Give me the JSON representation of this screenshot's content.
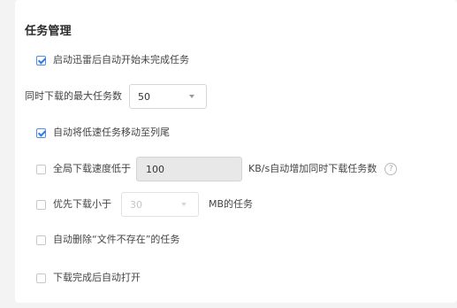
{
  "section": {
    "title": "任务管理"
  },
  "settings": {
    "auto_start": {
      "label": "启动迅雷后自动开始未完成任务",
      "checked": true
    },
    "max_tasks": {
      "label": "同时下载的最大任务数",
      "value": "50"
    },
    "move_slow": {
      "label": "自动将低速任务移动至列尾",
      "checked": true
    },
    "global_speed": {
      "label": "全局下载速度低于",
      "value": "100",
      "suffix": "KB/s自动增加同时下载任务数",
      "checked": false,
      "help_icon": "question-circle-icon"
    },
    "prefer_small": {
      "label": "优先下载小于",
      "value": "30",
      "suffix": "MB的任务",
      "checked": false
    },
    "auto_delete": {
      "label": "自动删除“文件不存在”的任务",
      "checked": false
    },
    "auto_open": {
      "label": "下载完成后自动打开",
      "checked": false
    }
  },
  "colors": {
    "accent": "#2f7ae5",
    "panel": "#ffffff",
    "background": "#f3f3f3"
  }
}
